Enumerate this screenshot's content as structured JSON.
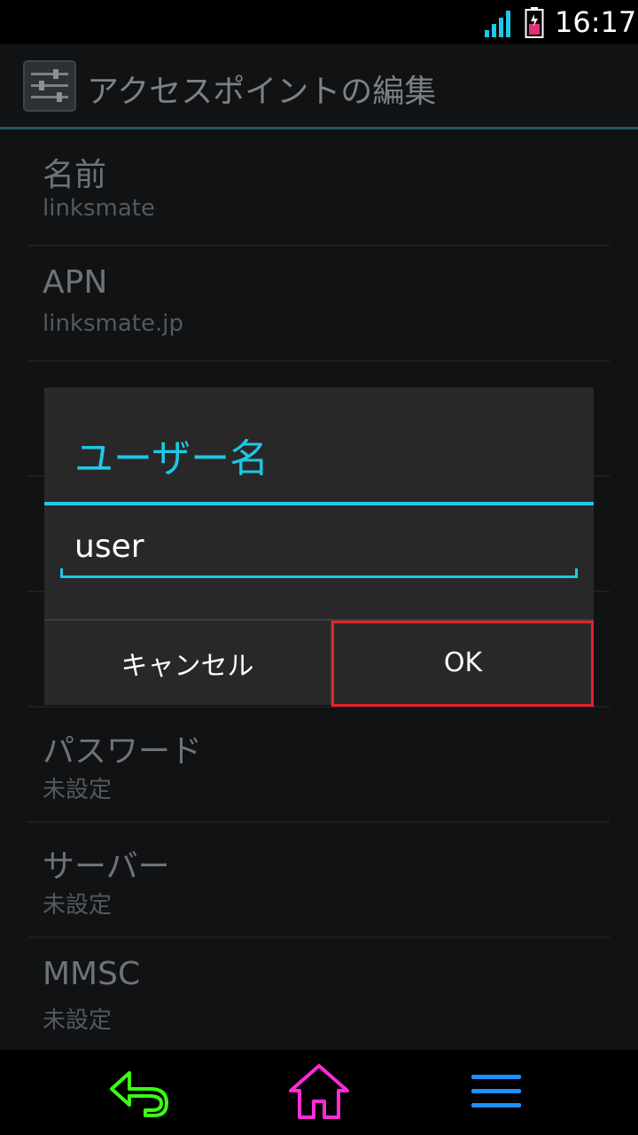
{
  "status_bar": {
    "time": "16:17",
    "signal_icon": "signal-icon",
    "battery_icon": "battery-icon"
  },
  "action_bar": {
    "title": "アクセスポイントの編集",
    "icon": "settings-sliders-icon"
  },
  "list": [
    {
      "label": "名前",
      "value": "linksmate"
    },
    {
      "label": "APN",
      "value": "linksmate.jp"
    },
    {
      "label": "",
      "value": ""
    },
    {
      "label": "",
      "value": ""
    },
    {
      "label": "",
      "value": ""
    },
    {
      "label": "パスワード",
      "value": "未設定"
    },
    {
      "label": "サーバー",
      "value": "未設定"
    },
    {
      "label": "MMSC",
      "value": "未設定"
    }
  ],
  "dialog": {
    "title": "ユーザー名",
    "input_value": "user",
    "cancel_label": "キャンセル",
    "ok_label": "OK"
  },
  "nav_bar": {
    "back_icon": "back-icon",
    "home_icon": "home-icon",
    "menu_icon": "menu-icon"
  },
  "colors": {
    "accent": "#1ec8e6",
    "highlight": "#e8212a",
    "back": "#39ff14",
    "home": "#ff2bd6",
    "menu": "#1e90ff"
  }
}
